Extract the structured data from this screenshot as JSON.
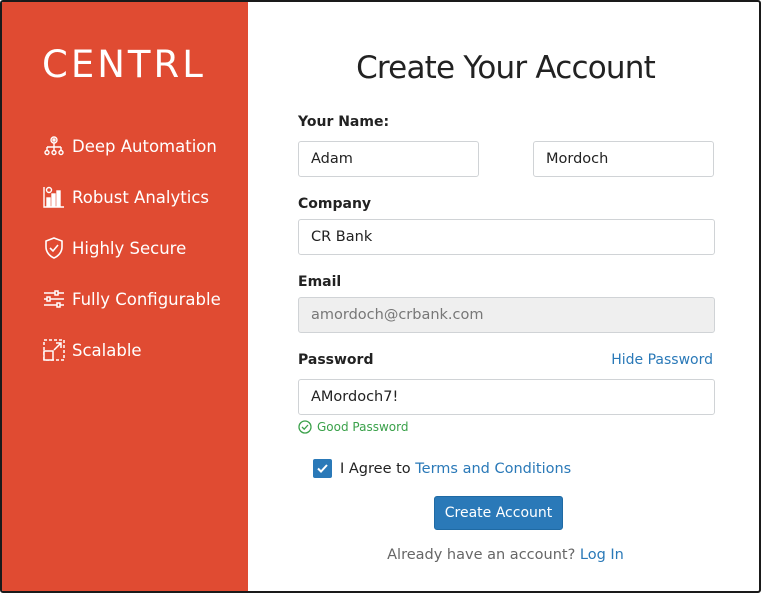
{
  "brand": {
    "logo": "CENTRL",
    "color": "#e04b32"
  },
  "features": [
    {
      "label": "Deep Automation",
      "icon": "automation-icon"
    },
    {
      "label": "Robust Analytics",
      "icon": "analytics-icon"
    },
    {
      "label": "Highly Secure",
      "icon": "shield-icon"
    },
    {
      "label": "Fully Configurable",
      "icon": "sliders-icon"
    },
    {
      "label": "Scalable",
      "icon": "scale-icon"
    }
  ],
  "form": {
    "title": "Create Your Account",
    "name_label": "Your Name:",
    "first_name": "Adam",
    "last_name": "Mordoch",
    "company_label": "Company",
    "company": "CR Bank",
    "email_label": "Email",
    "email": "amordoch@crbank.com",
    "password_label": "Password",
    "password": "AMordoch7!",
    "hide_password": "Hide Password",
    "password_status": "Good Password",
    "agree_text": "I Agree to",
    "terms_link": "Terms and Conditions",
    "agree_checked": true,
    "submit": "Create Account",
    "login_prompt": "Already have an account?",
    "login_link": "Log In"
  },
  "colors": {
    "accent": "#2a79b8",
    "success": "#3aa14a"
  }
}
